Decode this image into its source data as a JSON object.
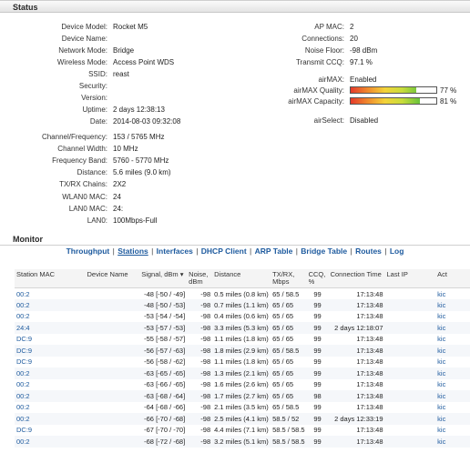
{
  "status": {
    "title": "Status",
    "left": [
      {
        "label": "Device Model:",
        "value": "Rocket M5"
      },
      {
        "label": "Device Name:",
        "value": ""
      },
      {
        "label": "Network Mode:",
        "value": "Bridge"
      },
      {
        "label": "Wireless Mode:",
        "value": "Access Point WDS"
      },
      {
        "label": "SSID:",
        "value": "reast"
      },
      {
        "label": "Security:",
        "value": ""
      },
      {
        "label": "Version:",
        "value": ""
      },
      {
        "label": "Uptime:",
        "value": "2 days 12:38:13"
      },
      {
        "label": "Date:",
        "value": "2014-08-03 09:32:08"
      },
      {
        "label": "Channel/Frequency:",
        "value": "153 / 5765 MHz"
      },
      {
        "label": "Channel Width:",
        "value": "10 MHz"
      },
      {
        "label": "Frequency Band:",
        "value": "5760 - 5770 MHz"
      },
      {
        "label": "Distance:",
        "value": "5.6 miles (9.0 km)"
      },
      {
        "label": "TX/RX Chains:",
        "value": "2X2"
      },
      {
        "label": "WLAN0 MAC:",
        "value": "24"
      },
      {
        "label": "LAN0 MAC:",
        "value": "24:"
      },
      {
        "label": "LAN0:",
        "value": "100Mbps-Full"
      }
    ],
    "right": [
      {
        "label": "AP MAC:",
        "value": "2"
      },
      {
        "label": "Connections:",
        "value": "20"
      },
      {
        "label": "Noise Floor:",
        "value": "-98 dBm"
      },
      {
        "label": "Transmit CCQ:",
        "value": "97.1 %"
      }
    ],
    "airmax": {
      "label": "airMAX:",
      "value": "Enabled"
    },
    "airmax_quality": {
      "label": "airMAX Quality:",
      "percent": 77,
      "text": "77 %"
    },
    "airmax_capacity": {
      "label": "airMAX Capacity:",
      "percent": 81,
      "text": "81 %"
    },
    "airselect": {
      "label": "airSelect:",
      "value": "Disabled"
    }
  },
  "monitor": {
    "title": "Monitor",
    "nav": [
      "Throughput",
      "Stations",
      "Interfaces",
      "DHCP Client",
      "ARP Table",
      "Bridge Table",
      "Routes",
      "Log"
    ],
    "active_tab": "Stations",
    "headers": {
      "mac": "Station MAC",
      "name": "Device Name",
      "signal": "Signal, dBm",
      "noise": "Noise, dBm",
      "distance": "Distance",
      "txrx": "TX/RX, Mbps",
      "ccq": "CCQ, %",
      "time": "Connection Time",
      "lastip": "Last IP",
      "action": "Act"
    },
    "rows": [
      {
        "mac": "00:2",
        "name": "",
        "signal": "-48 [-50 / -49]",
        "noise": "-98",
        "distance": "0.5 miles (0.8 km)",
        "txrx": "65 / 58.5",
        "ccq": "99",
        "time": "17:13:48",
        "action": "kic"
      },
      {
        "mac": "00:2",
        "name": "",
        "signal": "-48 [-50 / -53]",
        "noise": "-98",
        "distance": "0.7 miles (1.1 km)",
        "txrx": "65 / 65",
        "ccq": "99",
        "time": "17:13:48",
        "action": "kic"
      },
      {
        "mac": "00:2",
        "name": "",
        "signal": "-53 [-54 / -54]",
        "noise": "-98",
        "distance": "0.4 miles (0.6 km)",
        "txrx": "65 / 65",
        "ccq": "99",
        "time": "17:13:48",
        "action": "kic"
      },
      {
        "mac": "24:4",
        "name": "",
        "signal": "-53 [-57 / -53]",
        "noise": "-98",
        "distance": "3.3 miles (5.3 km)",
        "txrx": "65 / 65",
        "ccq": "99",
        "time": "2 days 12:18:07",
        "action": "kic"
      },
      {
        "mac": "DC:9",
        "name": "",
        "signal": "-55 [-58 / -57]",
        "noise": "-98",
        "distance": "1.1 miles (1.8 km)",
        "txrx": "65 / 65",
        "ccq": "99",
        "time": "17:13:48",
        "action": "kic"
      },
      {
        "mac": "DC:9",
        "name": "",
        "signal": "-56 [-57 / -63]",
        "noise": "-98",
        "distance": "1.8 miles (2.9 km)",
        "txrx": "65 / 58.5",
        "ccq": "99",
        "time": "17:13:48",
        "action": "kic"
      },
      {
        "mac": "DC:9",
        "name": "",
        "signal": "-56 [-58 / -62]",
        "noise": "-98",
        "distance": "1.1 miles (1.8 km)",
        "txrx": "65 / 65",
        "ccq": "99",
        "time": "17:13:48",
        "action": "kic"
      },
      {
        "mac": "00:2",
        "name": "",
        "signal": "-63 [-65 / -65]",
        "noise": "-98",
        "distance": "1.3 miles (2.1 km)",
        "txrx": "65 / 65",
        "ccq": "99",
        "time": "17:13:48",
        "action": "kic"
      },
      {
        "mac": "00:2",
        "name": "",
        "signal": "-63 [-66 / -65]",
        "noise": "-98",
        "distance": "1.6 miles (2.6 km)",
        "txrx": "65 / 65",
        "ccq": "99",
        "time": "17:13:48",
        "action": "kic"
      },
      {
        "mac": "00:2",
        "name": "",
        "signal": "-63 [-68 / -64]",
        "noise": "-98",
        "distance": "1.7 miles (2.7 km)",
        "txrx": "65 / 65",
        "ccq": "98",
        "time": "17:13:48",
        "action": "kic"
      },
      {
        "mac": "00:2",
        "name": "",
        "signal": "-64 [-68 / -66]",
        "noise": "-98",
        "distance": "2.1 miles (3.5 km)",
        "txrx": "65 / 58.5",
        "ccq": "99",
        "time": "17:13:48",
        "action": "kic"
      },
      {
        "mac": "00:2",
        "name": "",
        "signal": "-66 [-70 / -68]",
        "noise": "-98",
        "distance": "2.5 miles (4.1 km)",
        "txrx": "58.5 / 52",
        "ccq": "99",
        "time": "2 days 12:33:19",
        "action": "kic"
      },
      {
        "mac": "DC:9",
        "name": "",
        "signal": "-67 [-70 / -70]",
        "noise": "-98",
        "distance": "4.4 miles (7.1 km)",
        "txrx": "58.5 / 58.5",
        "ccq": "99",
        "time": "17:13:48",
        "action": "kic"
      },
      {
        "mac": "00:2",
        "name": "",
        "signal": "-68 [-72 / -68]",
        "noise": "-98",
        "distance": "3.2 miles (5.1 km)",
        "txrx": "58.5 / 58.5",
        "ccq": "99",
        "time": "17:13:48",
        "action": "kic"
      }
    ]
  },
  "colors": {
    "link": "#1d5a9e",
    "header_bg": "#e4e4e4"
  }
}
